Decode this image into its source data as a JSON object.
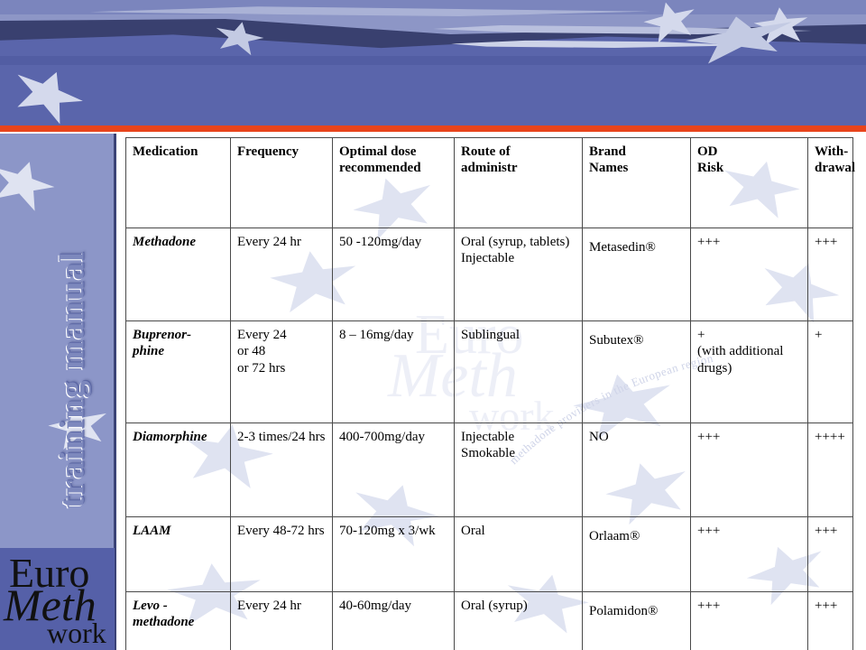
{
  "slide": {
    "sidebar_title": "training manual",
    "logo": {
      "line1": "Euro",
      "line2": "Meth",
      "line3": "work"
    },
    "watermark": {
      "line1": "Euro",
      "line2": "Meth",
      "line3": "work",
      "curve_text": "methadone providers in the European region"
    },
    "colors": {
      "banner_blue": "#5560a8",
      "banner_dark": "#39406f",
      "banner_sky": "#8d96c6",
      "accent_red": "#e8441c",
      "sidebar_blue": "#8c96c8",
      "logo_block_blue": "#5560a8",
      "star_pale": "#c3cae3",
      "table_border": "#4a4a4a",
      "text_black": "#000000"
    }
  },
  "table": {
    "headers": [
      "Medication",
      "Frequency",
      "Optimal dose recommended",
      "Route of administr",
      "Brand Names",
      "OD Risk",
      "With-drawal"
    ],
    "headers_wrapped": [
      [
        "Medication"
      ],
      [
        "Frequency"
      ],
      [
        "Optimal dose",
        "recommended"
      ],
      [
        "Route of",
        "administr"
      ],
      [
        "Brand",
        "Names"
      ],
      [
        "OD",
        "Risk"
      ],
      [
        "With-",
        "drawal"
      ]
    ],
    "rows": [
      {
        "medication": "Methadone",
        "frequency": "Every 24 hr",
        "dose": "50 -120mg/day",
        "route": "Oral (syrup, tablets)\nInjectable",
        "brand": "Metasedin®",
        "od_risk": "+++",
        "withdrawal": "+++"
      },
      {
        "medication": "Buprenor-\nphine",
        "frequency": "Every 24\nor 48\nor 72 hrs",
        "dose": "8 – 16mg/day",
        "route": "Sublingual",
        "brand": "Subutex®",
        "od_risk": "+\n(with additional drugs)",
        "withdrawal": "+"
      },
      {
        "medication": "Diamorphine",
        "frequency": "2-3 times/24 hrs",
        "dose": "400-700mg/day",
        "route": "Injectable\nSmokable",
        "brand": "NO",
        "od_risk": "+++",
        "withdrawal": "++++"
      },
      {
        "medication": "LAAM",
        "frequency": "Every 48-72 hrs",
        "dose": "70-120mg x 3/wk",
        "route": "Oral",
        "brand": "Orlaam®",
        "od_risk": "+++",
        "withdrawal": "+++"
      },
      {
        "medication": "Levo -\nmethadone",
        "frequency": "Every 24 hr",
        "dose": "40-60mg/day",
        "route": "Oral (syrup)",
        "brand": "Polamidon®",
        "od_risk": "+++",
        "withdrawal": "+++"
      }
    ]
  }
}
